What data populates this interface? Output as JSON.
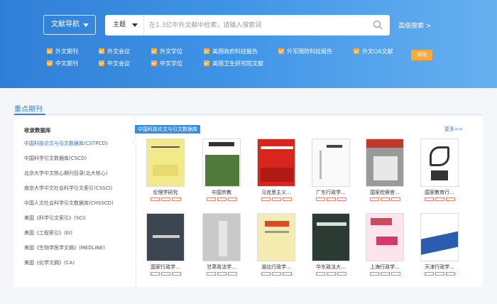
{
  "header": {
    "nav_label": "文献导航",
    "topic_label": "主题",
    "search_placeholder": "在1.3亿中外文献中检索，请输入搜索词",
    "advanced_label": "高级搜索 >",
    "clear_label": "清除"
  },
  "filters": [
    {
      "label": "外文期刊"
    },
    {
      "label": "外文会议"
    },
    {
      "label": "外文学位"
    },
    {
      "label": "美国政府科技报告"
    },
    {
      "label": "外军国防科技报告"
    },
    {
      "label": "外文OA文献"
    },
    {
      "label": "中文期刊"
    },
    {
      "label": "中文会议"
    },
    {
      "label": "中文学位"
    },
    {
      "label": "美国卫生研究院文献"
    }
  ],
  "section": {
    "title": "重点期刊"
  },
  "sidebar": {
    "heading": "收录数据库",
    "items": [
      {
        "label": "中国科技论文与引文数据库(CSTPCD)",
        "active": true
      },
      {
        "label": "中国科学引文数据库(CSCD)"
      },
      {
        "label": "北京大学中文核心期刊目录(北大核心)"
      },
      {
        "label": "南京大学中文社会科学引文索引(CSSCI)"
      },
      {
        "label": "中国人文社会科学引文数据库(CHSSCD)"
      },
      {
        "label": "美国《科学引文索引》(SCI)"
      },
      {
        "label": "美国《工程索引》(EI)"
      },
      {
        "label": "美国《生物学医学文摘》(MEDLINE)"
      },
      {
        "label": "美国《化学文摘》(CA)"
      }
    ]
  },
  "content": {
    "db_tag": "中国科技论文与引文数据库",
    "more_label": "更多>>",
    "journals": [
      {
        "title": "伦理学研究"
      },
      {
        "title": "中国宗教"
      },
      {
        "title": "马克思主义..."
      },
      {
        "title": "广东行政学..."
      },
      {
        "title": "国家检察官..."
      },
      {
        "title": "国家教育行..."
      },
      {
        "title": "国家行政学..."
      },
      {
        "title": "甘肃政法学..."
      },
      {
        "title": "湖北行政学..."
      },
      {
        "title": "华东政法大..."
      },
      {
        "title": "上海行政学..."
      },
      {
        "title": "天津行政学..."
      }
    ]
  },
  "colors": {
    "accent": "#3a7bd5",
    "checkbox": "#f7a93a",
    "banner": "#3f93e6"
  }
}
